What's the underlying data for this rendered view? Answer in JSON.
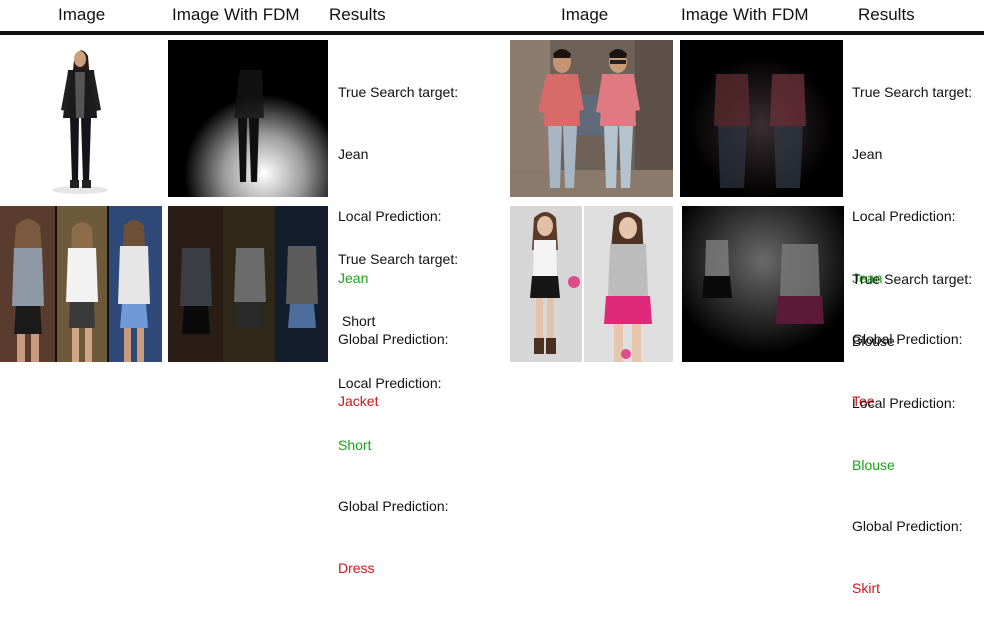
{
  "headers": {
    "image": "Image",
    "image_fdm": "Image With FDM",
    "results": "Results"
  },
  "cells": [
    {
      "target_label": "True Search target:",
      "target": "Jean",
      "local_label": "Local Prediction:",
      "local": "Jean",
      "global_label": "Global Prediction:",
      "global": "Jacket"
    },
    {
      "target_label": "True Search target:",
      "target": "Jean",
      "local_label": "Local Prediction:",
      "local": "Jean",
      "global_label": "Global Prediction:",
      "global": "Tee"
    },
    {
      "target_label": "True Search target:",
      "target": " Short",
      "local_label": "Local Prediction:",
      "local": "Short",
      "global_label": "Global Prediction:",
      "global": "Dress"
    },
    {
      "target_label": "True Search target:",
      "target": "Blouse",
      "local_label": "Local Prediction:",
      "local": "Blouse",
      "global_label": "Global Prediction:",
      "global": "Skirt"
    }
  ],
  "colors": {
    "correct": "#1aa31a",
    "wrong": "#d0141c"
  }
}
